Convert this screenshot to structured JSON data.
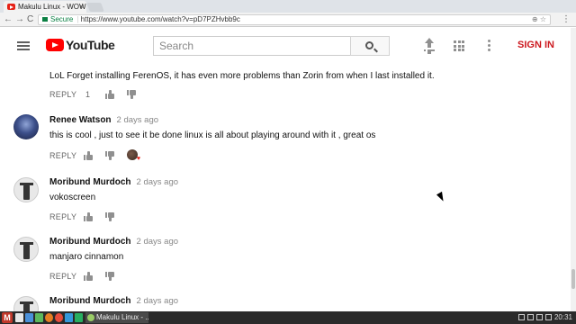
{
  "browser": {
    "tab_title": "Makulu Linux - WOW",
    "close_glyph": "×",
    "back_glyph": "←",
    "forward_glyph": "→",
    "reload_glyph": "C",
    "secure_label": "Secure",
    "url": "https://www.youtube.com/watch?v=pD7PZHvbb9c",
    "omnibox_right": "⊕ ☆",
    "menu_glyph": "⋮"
  },
  "masthead": {
    "logo_text": "YouTube",
    "search_placeholder": "Search",
    "signin_label": "SIGN IN"
  },
  "comments": [
    {
      "author": "",
      "time": "",
      "text": "LoL Forget installing FerenOS, it has even more problems than Zorin from when I last installed it.",
      "reply_label": "REPLY",
      "likes": "1",
      "hearted": false
    },
    {
      "author": "Renee Watson",
      "time": "2 days ago",
      "text": "this is cool , just to see it be done linux is all about playing around with it , great os",
      "reply_label": "REPLY",
      "likes": "",
      "hearted": true
    },
    {
      "author": "Moribund Murdoch",
      "time": "2 days ago",
      "text": "vokoscreen",
      "reply_label": "REPLY",
      "likes": "",
      "hearted": false
    },
    {
      "author": "Moribund Murdoch",
      "time": "2 days ago",
      "text": "manjaro cinnamon",
      "reply_label": "REPLY",
      "likes": "",
      "hearted": false
    },
    {
      "author": "Moribund Murdoch",
      "time": "2 days ago",
      "text": "",
      "reply_label": "",
      "likes": "",
      "hearted": false
    }
  ],
  "taskbar": {
    "start_label": "M",
    "window_label": "Makulu Linux - ...",
    "clock": "20:31"
  },
  "colors": {
    "brand_red": "#ff0000",
    "signin_red": "#cc181e",
    "secure_green": "#0b8043"
  }
}
